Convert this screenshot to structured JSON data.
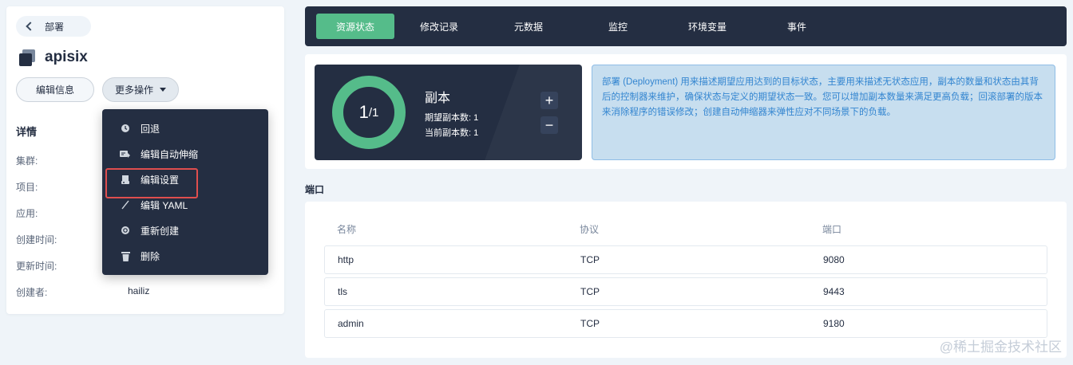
{
  "back": {
    "label": "部署"
  },
  "app": {
    "title": "apisix"
  },
  "actions": {
    "edit_label": "编辑信息",
    "more_label": "更多操作"
  },
  "details": {
    "title": "详情",
    "rows": [
      {
        "label": "集群:",
        "value": ""
      },
      {
        "label": "项目:",
        "value": ""
      },
      {
        "label": "应用:",
        "value": ""
      },
      {
        "label": "创建时间:",
        "value": ""
      },
      {
        "label": "更新时间:",
        "value": ""
      },
      {
        "label": "创建者:",
        "value": "hailiz"
      }
    ]
  },
  "menu": {
    "items": [
      {
        "label": "回退",
        "icon": "history-icon"
      },
      {
        "label": "编辑自动伸缩",
        "icon": "autoscale-icon"
      },
      {
        "label": "编辑设置",
        "icon": "settings-icon"
      },
      {
        "label": "编辑 YAML",
        "icon": "yaml-icon"
      },
      {
        "label": "重新创建",
        "icon": "refresh-icon"
      },
      {
        "label": "删除",
        "icon": "trash-icon"
      }
    ],
    "highlighted": "编辑设置"
  },
  "tabs": [
    {
      "label": "资源状态",
      "active": true
    },
    {
      "label": "修改记录"
    },
    {
      "label": "元数据"
    },
    {
      "label": "监控"
    },
    {
      "label": "环境变量"
    },
    {
      "label": "事件"
    }
  ],
  "replica": {
    "current": "1",
    "desired": "1",
    "title": "副本",
    "desired_line": "期望副本数: 1",
    "current_line": "当前副本数: 1",
    "plus": "+",
    "minus": "−"
  },
  "description": "部署 (Deployment) 用来描述期望应用达到的目标状态，主要用来描述无状态应用，副本的数量和状态由其背后的控制器来维护，确保状态与定义的期望状态一致。您可以增加副本数量来满足更高负载；回滚部署的版本来消除程序的错误修改；创建自动伸缩器来弹性应对不同场景下的负载。",
  "ports": {
    "label": "端口",
    "headers": [
      "名称",
      "协议",
      "端口"
    ],
    "rows": [
      [
        "http",
        "TCP",
        "9080"
      ],
      [
        "tls",
        "TCP",
        "9443"
      ],
      [
        "admin",
        "TCP",
        "9180"
      ]
    ]
  },
  "watermark": "@稀土掘金技术社区",
  "colors": {
    "accent": "#55bc8a",
    "dark": "#242e42",
    "highlight": "#e04e4e",
    "info": "#3385d0"
  }
}
